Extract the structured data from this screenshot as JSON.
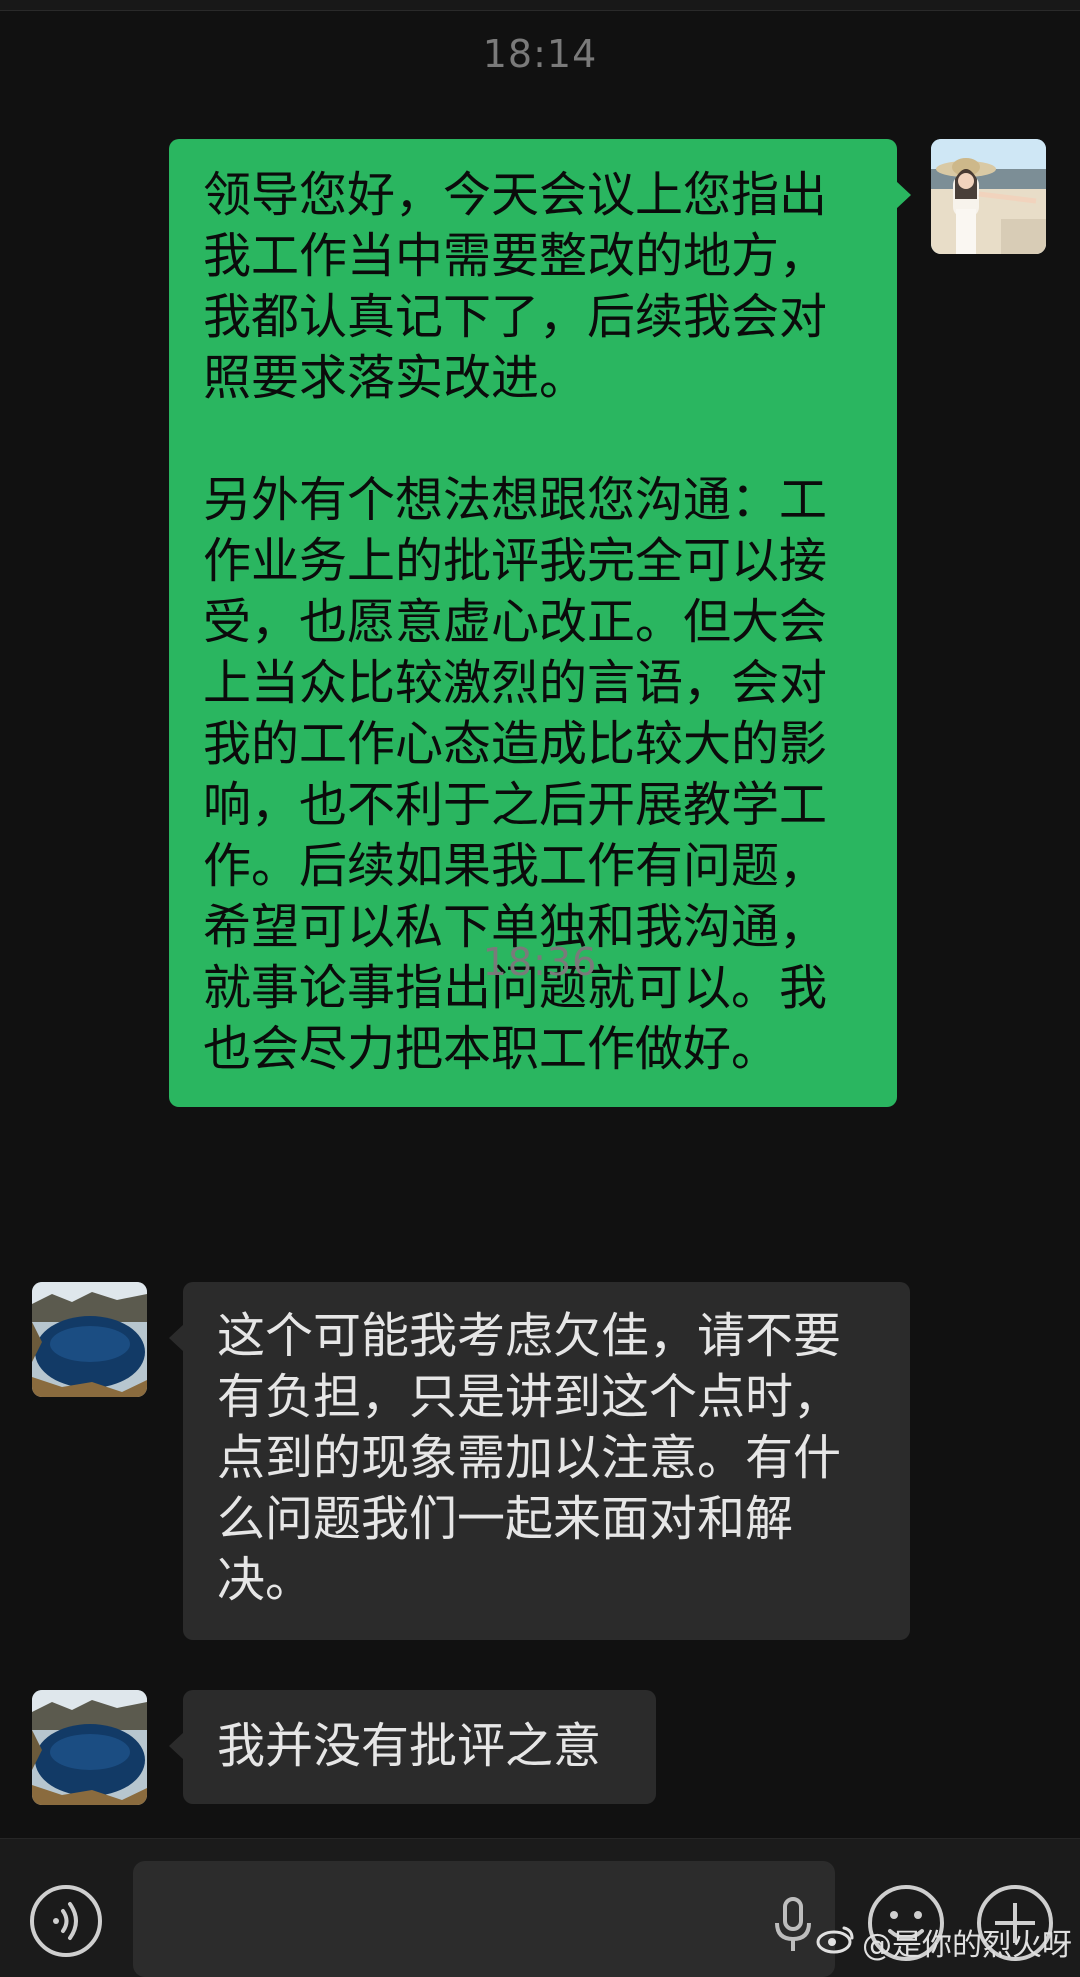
{
  "chat": {
    "messages": [
      {
        "timestamp": "18:14",
        "sender": "me",
        "text": "领导您好，今天会议上您指出我工作当中需要整改的地方，我都认真记下了，后续我会对照要求落实改进。\n\n另外有个想法想跟您沟通：工作业务上的批评我完全可以接受，也愿意虚心改正。但大会上当众比较激烈的言语，会对我的工作心态造成比较大的影响，也不利于之后开展教学工作。后续如果我工作有问题，希望可以私下单独和我沟通，就事论事指出问题就可以。我也会尽力把本职工作做好。"
      },
      {
        "timestamp": "18:36",
        "sender": "other",
        "text": "这个可能我考虑欠佳，请不要有负担，只是讲到这个点时，点到的现象需加以注意。有什么问题我们一起来面对和解决。"
      },
      {
        "sender": "other",
        "text": "我并没有批评之意"
      }
    ]
  },
  "input_bar": {
    "voice_icon": "voice-icon",
    "mic_icon": "microphone-icon",
    "emoji_icon": "emoji-icon",
    "plus_icon": "plus-icon"
  },
  "watermark": {
    "text": "@是你的烈火呀",
    "icon": "weibo-icon"
  },
  "colors": {
    "background": "#111111",
    "my_bubble": "#2ab660",
    "their_bubble": "#2b2b2b",
    "timestamp": "#7a7a7a"
  }
}
